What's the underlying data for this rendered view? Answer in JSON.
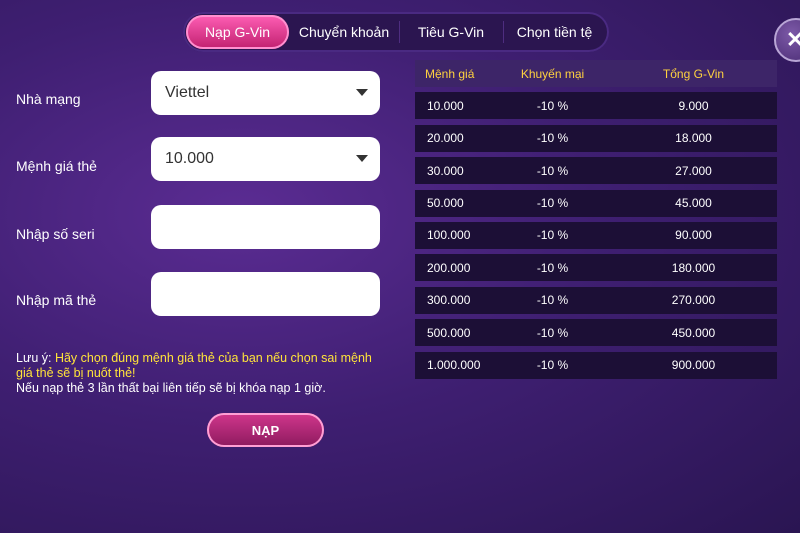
{
  "tabs": [
    {
      "label": "Nạp G-Vin",
      "active": true
    },
    {
      "label": "Chuyển khoản",
      "active": false
    },
    {
      "label": "Tiêu G-Vin",
      "active": false
    },
    {
      "label": "Chọn tiền tệ",
      "active": false
    }
  ],
  "form": {
    "network_label": "Nhà mạng",
    "network_value": "Viettel",
    "denomination_label": "Mệnh giá thẻ",
    "denomination_value": "10.000",
    "serial_label": "Nhập số seri",
    "serial_value": "",
    "code_label": "Nhập mã thẻ",
    "code_value": ""
  },
  "note": {
    "prefix": "Lưu ý: ",
    "warning": "Hãy chọn đúng mệnh giá thẻ của bạn nếu chọn sai mệnh giá thẻ sẽ bị nuốt thẻ!",
    "lock": "Nếu nạp thẻ 3 lần thất bại liên tiếp sẽ bị khóa nạp 1 giờ."
  },
  "submit_label": "NẠP",
  "table": {
    "headers": [
      "Mệnh giá",
      "Khuyến mại",
      "Tổng G-Vin"
    ],
    "rows": [
      [
        "10.000",
        "-10 %",
        "9.000"
      ],
      [
        "20.000",
        "-10 %",
        "18.000"
      ],
      [
        "30.000",
        "-10 %",
        "27.000"
      ],
      [
        "50.000",
        "-10 %",
        "45.000"
      ],
      [
        "100.000",
        "-10 %",
        "90.000"
      ],
      [
        "200.000",
        "-10 %",
        "180.000"
      ],
      [
        "300.000",
        "-10 %",
        "270.000"
      ],
      [
        "500.000",
        "-10 %",
        "450.000"
      ],
      [
        "1.000.000",
        "-10 %",
        "900.000"
      ]
    ]
  },
  "colors": {
    "accent": "#e0338f",
    "header_text": "#ffd23f",
    "warning_text": "#ffe33a",
    "background": "#3f1f72"
  }
}
